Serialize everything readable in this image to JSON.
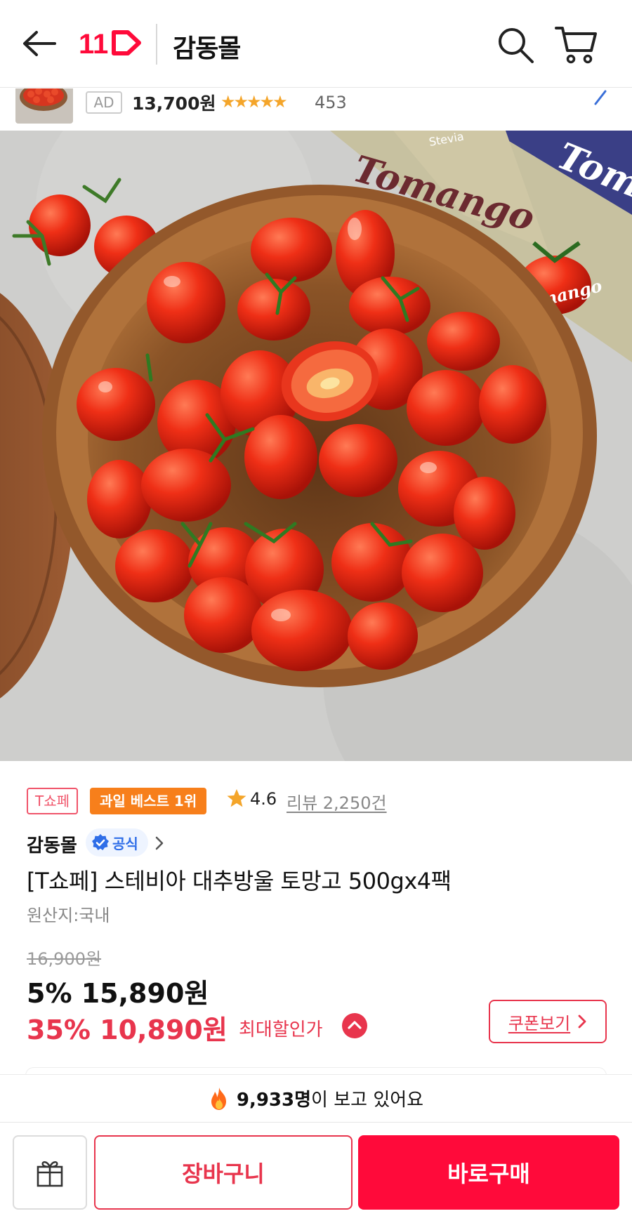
{
  "header": {
    "logo_text": "11",
    "store_name": "감동몰"
  },
  "ad": {
    "badge": "AD",
    "price": "13,700원",
    "rating": 4.5,
    "stars": "★★★★★",
    "review_count": "453"
  },
  "product_image": {
    "box_text_1": "Tomango",
    "box_text_2": "Stevia"
  },
  "product": {
    "badge_tshop": "T쇼페",
    "badge_best": "과일 베스트 1위",
    "rating": "4.6",
    "review_link": "리뷰 2,250건",
    "seller": "감동몰",
    "official_label": "공식",
    "title": "[T쇼페] 스테비아 대추방울 토망고 500gx4팩",
    "origin": "원산지:국내",
    "original_price": "16,900원",
    "sale_price": "5% 15,890원",
    "max_discount_price": "35% 10,890원",
    "max_discount_label": "최대할인가",
    "coupon_label": "쿠폰보기"
  },
  "viewers": {
    "count": "9,933명",
    "suffix": "이 보고 있어요"
  },
  "bottom": {
    "cart_label": "장바구니",
    "buy_label": "바로구매"
  },
  "colors": {
    "brand_red": "#ff0a3a",
    "price_red": "#e8354d",
    "best_orange": "#f77f1b",
    "official_blue": "#2f6ee8",
    "star": "#f4a52a"
  }
}
